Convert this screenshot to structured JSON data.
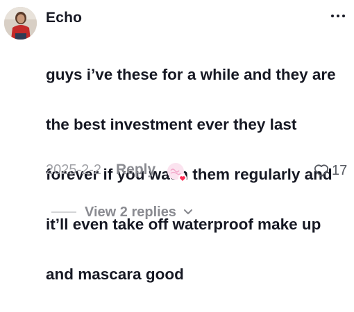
{
  "comment": {
    "username": "Echo",
    "text_lines": [
      "guys i’ve these for a while and they are",
      "the best investment ever they last",
      "forever if you wash them regularly and",
      "it’ll even take off waterproof make up",
      "and mascara good"
    ],
    "date": "2025-2-2",
    "reply_label": "Reply",
    "like_count": "17",
    "view_replies_label": "View 2 replies",
    "icons": {
      "more": "more-horizontal-icon",
      "like": "heart-outline-icon",
      "expand": "chevron-down-icon",
      "sticker": "creator-liked-badge-icon"
    },
    "colors": {
      "primary_text": "#161823",
      "secondary_text": "#8a8b91",
      "date_text": "#a1a2a7",
      "sticker_heart": "#fe2c55"
    }
  }
}
